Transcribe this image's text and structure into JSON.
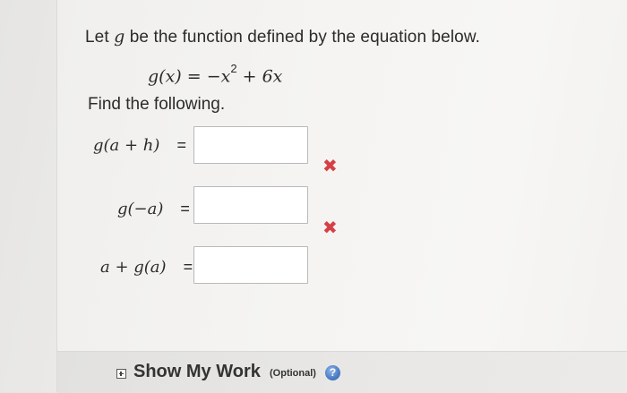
{
  "problem": {
    "prompt_prefix": "Let ",
    "prompt_var": "g",
    "prompt_suffix": " be the function defined by the equation below.",
    "equation_lhs": "g(x)",
    "equation_rel": " = −x",
    "equation_exp": "2",
    "equation_rest": " + 6x",
    "find_text": "Find the following."
  },
  "items": [
    {
      "label": "g(a + h)",
      "equals": "=",
      "value": "",
      "status": "incorrect",
      "mark": "✖"
    },
    {
      "label": "g(−a)",
      "equals": "=",
      "value": "",
      "status": "incorrect",
      "mark": "✖"
    },
    {
      "label": "a + g(a)",
      "equals": "=",
      "value": "",
      "status": "unanswered"
    }
  ],
  "footer": {
    "show_work_label": "Show My Work",
    "optional_label": "(Optional)",
    "help_glyph": "?",
    "expand_icon": "plus-square-icon",
    "help_icon": "question-circle-icon"
  },
  "colors": {
    "error_mark": "#d64045",
    "help_icon": "#4f7fc7"
  }
}
